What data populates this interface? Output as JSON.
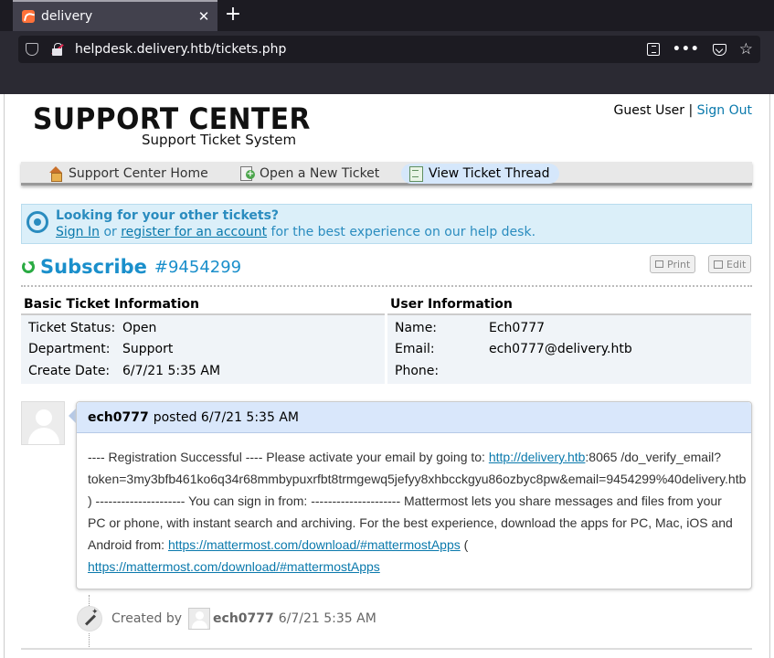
{
  "browser": {
    "tab_title": "delivery",
    "close_glyph": "✕",
    "new_tab_glyph": "+",
    "url": "helpdesk.delivery.htb/tickets.php",
    "overflow_glyph": "•••",
    "star_glyph": "☆"
  },
  "header": {
    "logo_main": "SUPPORT CENTER",
    "logo_sub": "Support Ticket System",
    "user_label": "Guest User",
    "separator": "|",
    "signout_label": "Sign Out"
  },
  "nav": {
    "items": [
      {
        "label": "Support Center Home",
        "icon": "home-icon"
      },
      {
        "label": "Open a New Ticket",
        "icon": "new-ticket-icon"
      },
      {
        "label": "View Ticket Thread",
        "icon": "ticket-thread-icon",
        "active": true
      }
    ]
  },
  "notice": {
    "title": "Looking for your other tickets?",
    "signin_label": "Sign In",
    "or_text": "or",
    "register_label": "register for an account",
    "tail_text": "for the best experience on our help desk."
  },
  "ticket": {
    "subject": "Subscribe",
    "number": "#9454299",
    "print_label": "Print",
    "edit_label": "Edit"
  },
  "basic_info": {
    "heading": "Basic Ticket Information",
    "rows": [
      {
        "label": "Ticket Status:",
        "value": "Open"
      },
      {
        "label": "Department:",
        "value": "Support"
      },
      {
        "label": "Create Date:",
        "value": "6/7/21 5:35 AM"
      }
    ]
  },
  "user_info": {
    "heading": "User Information",
    "rows": [
      {
        "label": "Name:",
        "value": "Ech0777"
      },
      {
        "label": "Email:",
        "value": "ech0777@delivery.htb"
      },
      {
        "label": "Phone:",
        "value": ""
      }
    ]
  },
  "thread": {
    "author": "ech0777",
    "posted_text": "posted 6/7/21 5:35 AM",
    "body_part1": "---- Registration Successful ---- Please activate your email by going to: ",
    "link1": "http://delivery.htb",
    "body_part2": ":8065 /do_verify_email?token=3my3bfb461ko6q34r68mmbypuxrfbt8trmgewq5jefyy8xhbcckgyu86ozbyc8pw&email=9454299%40delivery.htb ) --------------------- You can sign in from: --------------------- Mattermost lets you share messages and files from your PC or phone, with instant search and archiving. For the best experience, download the apps for PC, Mac, iOS and Android from: ",
    "link2": "https://mattermost.com/download/#mattermostApps",
    "body_part3": " ( ",
    "link3": "https://mattermost.com/download/#mattermostApps"
  },
  "event": {
    "created_by": "Created by",
    "user": "ech0777",
    "time": "6/7/21 5:35 AM"
  }
}
